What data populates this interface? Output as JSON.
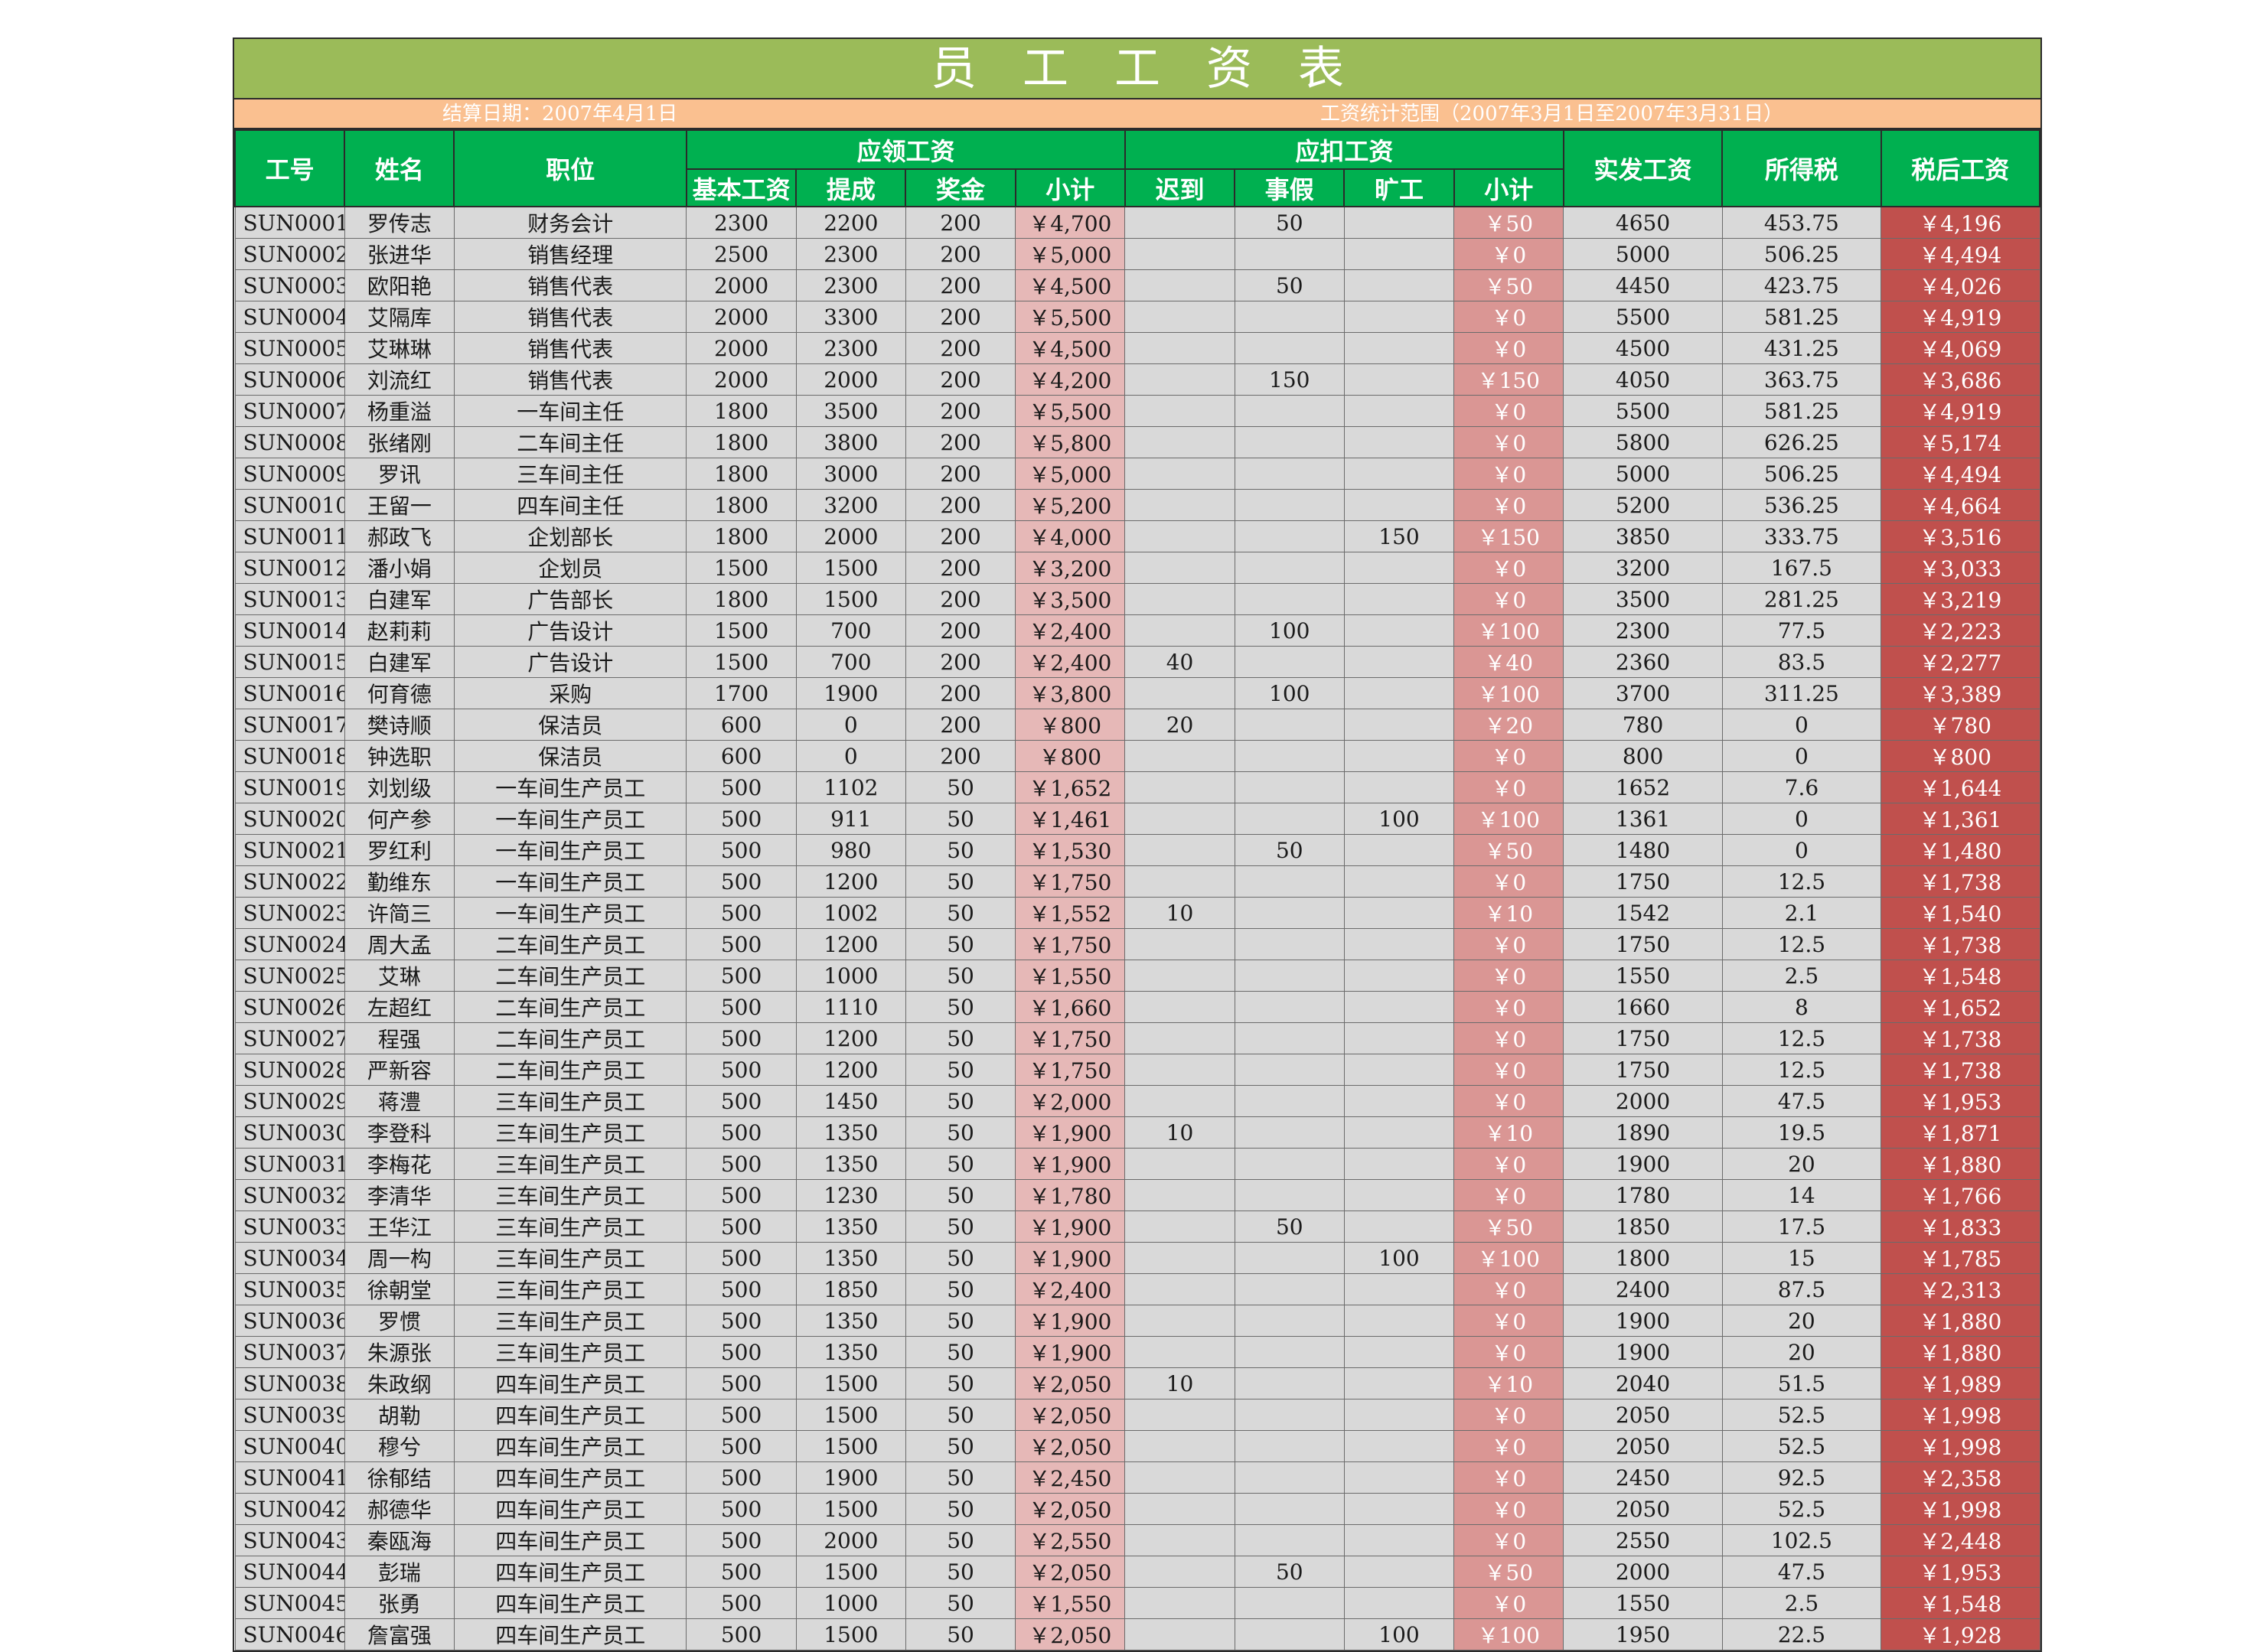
{
  "title": "员　工　工　资　表",
  "info": {
    "settle_date": "结算日期：2007年4月1日",
    "range": "工资统计范围（2007年3月1日至2007年3月31日）"
  },
  "headers": {
    "id": "工号",
    "name": "姓名",
    "position": "职位",
    "earn_group": "应领工资",
    "deduct_group": "应扣工资",
    "actual": "实发工资",
    "tax": "所得税",
    "after_tax": "税后工资",
    "earn_cols": [
      "基本工资",
      "提成",
      "奖金",
      "小计"
    ],
    "deduct_cols": [
      "迟到",
      "事假",
      "旷工",
      "小计"
    ]
  },
  "rows": [
    [
      "SUN0001",
      "罗传志",
      "财务会计",
      "2300",
      "2200",
      "200",
      "￥4,700",
      "",
      "50",
      "",
      "￥50",
      "4650",
      "453.75",
      "￥4,196"
    ],
    [
      "SUN0002",
      "张进华",
      "销售经理",
      "2500",
      "2300",
      "200",
      "￥5,000",
      "",
      "",
      "",
      "￥0",
      "5000",
      "506.25",
      "￥4,494"
    ],
    [
      "SUN0003",
      "欧阳艳",
      "销售代表",
      "2000",
      "2300",
      "200",
      "￥4,500",
      "",
      "50",
      "",
      "￥50",
      "4450",
      "423.75",
      "￥4,026"
    ],
    [
      "SUN0004",
      "艾隔库",
      "销售代表",
      "2000",
      "3300",
      "200",
      "￥5,500",
      "",
      "",
      "",
      "￥0",
      "5500",
      "581.25",
      "￥4,919"
    ],
    [
      "SUN0005",
      "艾琳琳",
      "销售代表",
      "2000",
      "2300",
      "200",
      "￥4,500",
      "",
      "",
      "",
      "￥0",
      "4500",
      "431.25",
      "￥4,069"
    ],
    [
      "SUN0006",
      "刘流红",
      "销售代表",
      "2000",
      "2000",
      "200",
      "￥4,200",
      "",
      "150",
      "",
      "￥150",
      "4050",
      "363.75",
      "￥3,686"
    ],
    [
      "SUN0007",
      "杨重溢",
      "一车间主任",
      "1800",
      "3500",
      "200",
      "￥5,500",
      "",
      "",
      "",
      "￥0",
      "5500",
      "581.25",
      "￥4,919"
    ],
    [
      "SUN0008",
      "张绪刚",
      "二车间主任",
      "1800",
      "3800",
      "200",
      "￥5,800",
      "",
      "",
      "",
      "￥0",
      "5800",
      "626.25",
      "￥5,174"
    ],
    [
      "SUN0009",
      "罗讯",
      "三车间主任",
      "1800",
      "3000",
      "200",
      "￥5,000",
      "",
      "",
      "",
      "￥0",
      "5000",
      "506.25",
      "￥4,494"
    ],
    [
      "SUN0010",
      "王留一",
      "四车间主任",
      "1800",
      "3200",
      "200",
      "￥5,200",
      "",
      "",
      "",
      "￥0",
      "5200",
      "536.25",
      "￥4,664"
    ],
    [
      "SUN0011",
      "郝政飞",
      "企划部长",
      "1800",
      "2000",
      "200",
      "￥4,000",
      "",
      "",
      "150",
      "￥150",
      "3850",
      "333.75",
      "￥3,516"
    ],
    [
      "SUN0012",
      "潘小娟",
      "企划员",
      "1500",
      "1500",
      "200",
      "￥3,200",
      "",
      "",
      "",
      "￥0",
      "3200",
      "167.5",
      "￥3,033"
    ],
    [
      "SUN0013",
      "白建军",
      "广告部长",
      "1800",
      "1500",
      "200",
      "￥3,500",
      "",
      "",
      "",
      "￥0",
      "3500",
      "281.25",
      "￥3,219"
    ],
    [
      "SUN0014",
      "赵莉莉",
      "广告设计",
      "1500",
      "700",
      "200",
      "￥2,400",
      "",
      "100",
      "",
      "￥100",
      "2300",
      "77.5",
      "￥2,223"
    ],
    [
      "SUN0015",
      "白建军",
      "广告设计",
      "1500",
      "700",
      "200",
      "￥2,400",
      "40",
      "",
      "",
      "￥40",
      "2360",
      "83.5",
      "￥2,277"
    ],
    [
      "SUN0016",
      "何育德",
      "采购",
      "1700",
      "1900",
      "200",
      "￥3,800",
      "",
      "100",
      "",
      "￥100",
      "3700",
      "311.25",
      "￥3,389"
    ],
    [
      "SUN0017",
      "樊诗顺",
      "保洁员",
      "600",
      "0",
      "200",
      "￥800",
      "20",
      "",
      "",
      "￥20",
      "780",
      "0",
      "￥780"
    ],
    [
      "SUN0018",
      "钟选职",
      "保洁员",
      "600",
      "0",
      "200",
      "￥800",
      "",
      "",
      "",
      "￥0",
      "800",
      "0",
      "￥800"
    ],
    [
      "SUN0019",
      "刘划级",
      "一车间生产员工",
      "500",
      "1102",
      "50",
      "￥1,652",
      "",
      "",
      "",
      "￥0",
      "1652",
      "7.6",
      "￥1,644"
    ],
    [
      "SUN0020",
      "何产参",
      "一车间生产员工",
      "500",
      "911",
      "50",
      "￥1,461",
      "",
      "",
      "100",
      "￥100",
      "1361",
      "0",
      "￥1,361"
    ],
    [
      "SUN0021",
      "罗红利",
      "一车间生产员工",
      "500",
      "980",
      "50",
      "￥1,530",
      "",
      "50",
      "",
      "￥50",
      "1480",
      "0",
      "￥1,480"
    ],
    [
      "SUN0022",
      "勤维东",
      "一车间生产员工",
      "500",
      "1200",
      "50",
      "￥1,750",
      "",
      "",
      "",
      "￥0",
      "1750",
      "12.5",
      "￥1,738"
    ],
    [
      "SUN0023",
      "许简三",
      "一车间生产员工",
      "500",
      "1002",
      "50",
      "￥1,552",
      "10",
      "",
      "",
      "￥10",
      "1542",
      "2.1",
      "￥1,540"
    ],
    [
      "SUN0024",
      "周大孟",
      "二车间生产员工",
      "500",
      "1200",
      "50",
      "￥1,750",
      "",
      "",
      "",
      "￥0",
      "1750",
      "12.5",
      "￥1,738"
    ],
    [
      "SUN0025",
      "艾琳",
      "二车间生产员工",
      "500",
      "1000",
      "50",
      "￥1,550",
      "",
      "",
      "",
      "￥0",
      "1550",
      "2.5",
      "￥1,548"
    ],
    [
      "SUN0026",
      "左超红",
      "二车间生产员工",
      "500",
      "1110",
      "50",
      "￥1,660",
      "",
      "",
      "",
      "￥0",
      "1660",
      "8",
      "￥1,652"
    ],
    [
      "SUN0027",
      "程强",
      "二车间生产员工",
      "500",
      "1200",
      "50",
      "￥1,750",
      "",
      "",
      "",
      "￥0",
      "1750",
      "12.5",
      "￥1,738"
    ],
    [
      "SUN0028",
      "严新容",
      "二车间生产员工",
      "500",
      "1200",
      "50",
      "￥1,750",
      "",
      "",
      "",
      "￥0",
      "1750",
      "12.5",
      "￥1,738"
    ],
    [
      "SUN0029",
      "蒋澧",
      "三车间生产员工",
      "500",
      "1450",
      "50",
      "￥2,000",
      "",
      "",
      "",
      "￥0",
      "2000",
      "47.5",
      "￥1,953"
    ],
    [
      "SUN0030",
      "李登科",
      "三车间生产员工",
      "500",
      "1350",
      "50",
      "￥1,900",
      "10",
      "",
      "",
      "￥10",
      "1890",
      "19.5",
      "￥1,871"
    ],
    [
      "SUN0031",
      "李梅花",
      "三车间生产员工",
      "500",
      "1350",
      "50",
      "￥1,900",
      "",
      "",
      "",
      "￥0",
      "1900",
      "20",
      "￥1,880"
    ],
    [
      "SUN0032",
      "李清华",
      "三车间生产员工",
      "500",
      "1230",
      "50",
      "￥1,780",
      "",
      "",
      "",
      "￥0",
      "1780",
      "14",
      "￥1,766"
    ],
    [
      "SUN0033",
      "王华江",
      "三车间生产员工",
      "500",
      "1350",
      "50",
      "￥1,900",
      "",
      "50",
      "",
      "￥50",
      "1850",
      "17.5",
      "￥1,833"
    ],
    [
      "SUN0034",
      "周一构",
      "三车间生产员工",
      "500",
      "1350",
      "50",
      "￥1,900",
      "",
      "",
      "100",
      "￥100",
      "1800",
      "15",
      "￥1,785"
    ],
    [
      "SUN0035",
      "徐朝堂",
      "三车间生产员工",
      "500",
      "1850",
      "50",
      "￥2,400",
      "",
      "",
      "",
      "￥0",
      "2400",
      "87.5",
      "￥2,313"
    ],
    [
      "SUN0036",
      "罗惯",
      "三车间生产员工",
      "500",
      "1350",
      "50",
      "￥1,900",
      "",
      "",
      "",
      "￥0",
      "1900",
      "20",
      "￥1,880"
    ],
    [
      "SUN0037",
      "朱源张",
      "三车间生产员工",
      "500",
      "1350",
      "50",
      "￥1,900",
      "",
      "",
      "",
      "￥0",
      "1900",
      "20",
      "￥1,880"
    ],
    [
      "SUN0038",
      "朱政纲",
      "四车间生产员工",
      "500",
      "1500",
      "50",
      "￥2,050",
      "10",
      "",
      "",
      "￥10",
      "2040",
      "51.5",
      "￥1,989"
    ],
    [
      "SUN0039",
      "胡勒",
      "四车间生产员工",
      "500",
      "1500",
      "50",
      "￥2,050",
      "",
      "",
      "",
      "￥0",
      "2050",
      "52.5",
      "￥1,998"
    ],
    [
      "SUN0040",
      "穆兮",
      "四车间生产员工",
      "500",
      "1500",
      "50",
      "￥2,050",
      "",
      "",
      "",
      "￥0",
      "2050",
      "52.5",
      "￥1,998"
    ],
    [
      "SUN0041",
      "徐郁结",
      "四车间生产员工",
      "500",
      "1900",
      "50",
      "￥2,450",
      "",
      "",
      "",
      "￥0",
      "2450",
      "92.5",
      "￥2,358"
    ],
    [
      "SUN0042",
      "郝德华",
      "四车间生产员工",
      "500",
      "1500",
      "50",
      "￥2,050",
      "",
      "",
      "",
      "￥0",
      "2050",
      "52.5",
      "￥1,998"
    ],
    [
      "SUN0043",
      "秦瓯海",
      "四车间生产员工",
      "500",
      "2000",
      "50",
      "￥2,550",
      "",
      "",
      "",
      "￥0",
      "2550",
      "102.5",
      "￥2,448"
    ],
    [
      "SUN0044",
      "彭瑞",
      "四车间生产员工",
      "500",
      "1500",
      "50",
      "￥2,050",
      "",
      "50",
      "",
      "￥50",
      "2000",
      "47.5",
      "￥1,953"
    ],
    [
      "SUN0045",
      "张勇",
      "四车间生产员工",
      "500",
      "1000",
      "50",
      "￥1,550",
      "",
      "",
      "",
      "￥0",
      "1550",
      "2.5",
      "￥1,548"
    ],
    [
      "SUN0046",
      "詹富强",
      "四车间生产员工",
      "500",
      "1500",
      "50",
      "￥2,050",
      "",
      "",
      "100",
      "￥100",
      "1950",
      "22.5",
      "￥1,928"
    ]
  ]
}
